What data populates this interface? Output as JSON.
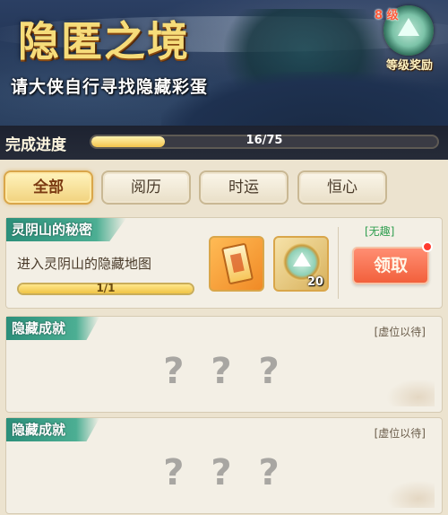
{
  "header": {
    "title": "隐匿之境",
    "subtitle": "请大侠自行寻找隐藏彩蛋",
    "level_badge": {
      "level_text": "8 级",
      "label": "等级奖励",
      "icon": "mountain-medal-icon"
    }
  },
  "progress": {
    "label": "完成进度",
    "current": 16,
    "total": 75,
    "text": "16/75",
    "fraction": 0.213
  },
  "tabs": [
    {
      "label": "全部",
      "active": true
    },
    {
      "label": "阅历",
      "active": false
    },
    {
      "label": "时运",
      "active": false
    },
    {
      "label": "恒心",
      "active": false
    }
  ],
  "cards": [
    {
      "title": "灵阴山的秘密",
      "status_tag": "[无趣]",
      "description": "进入灵阴山的隐藏地图",
      "progress_text": "1/1",
      "progress_fraction": 1.0,
      "rewards": [
        {
          "icon": "scroll-icon",
          "qty": ""
        },
        {
          "icon": "mountain-medal-icon",
          "qty": "20"
        }
      ],
      "claim_label": "领取"
    },
    {
      "title": "隐藏成就",
      "status_tag": "[虚位以待]",
      "placeholder": "? ? ?"
    },
    {
      "title": "隐藏成就",
      "status_tag": "[虚位以待]",
      "placeholder": "? ? ?"
    }
  ],
  "colors": {
    "accent_gold": "#f6dc7a",
    "header_teal": "#2c8f7a",
    "claim_red": "#f2603c",
    "page_bg": "#ece3cf"
  }
}
